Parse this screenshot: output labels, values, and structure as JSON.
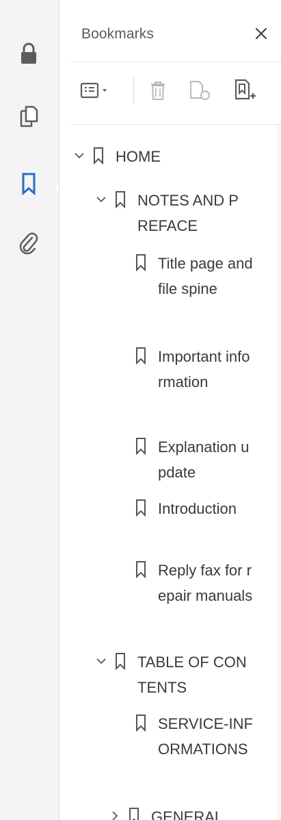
{
  "rail": {
    "icons": [
      "lock-icon",
      "pages-icon",
      "bookmark-icon",
      "attachment-icon"
    ],
    "active_color": "#2b6cc4",
    "icon_color": "#5c5c5c"
  },
  "panel": {
    "title": "Bookmarks",
    "close_glyph": "✕"
  },
  "toolbar": {
    "icons": [
      "options-menu-icon",
      "delete-bookmark-icon",
      "new-bookmark-icon",
      "add-bookmark-icon"
    ]
  },
  "bookmarks": [
    {
      "label": "HOME",
      "expanded": true,
      "level": 0
    },
    {
      "label": "NOTES AND PREFACE",
      "expanded": true,
      "level": 1
    },
    {
      "label": "Title page and file spine",
      "level": 2
    },
    {
      "label": "Important information",
      "level": 2
    },
    {
      "label": "Explanation update",
      "level": 2
    },
    {
      "label": "Introduction",
      "level": 2
    },
    {
      "label": "Reply fax for repair manuals",
      "level": 2
    },
    {
      "label": "TABLE OF CONTENTS",
      "expanded": true,
      "level": 1
    },
    {
      "label": "SERVICE-INFORMATIONS",
      "level": 2
    },
    {
      "label": "GENERAL",
      "level": 2
    }
  ]
}
